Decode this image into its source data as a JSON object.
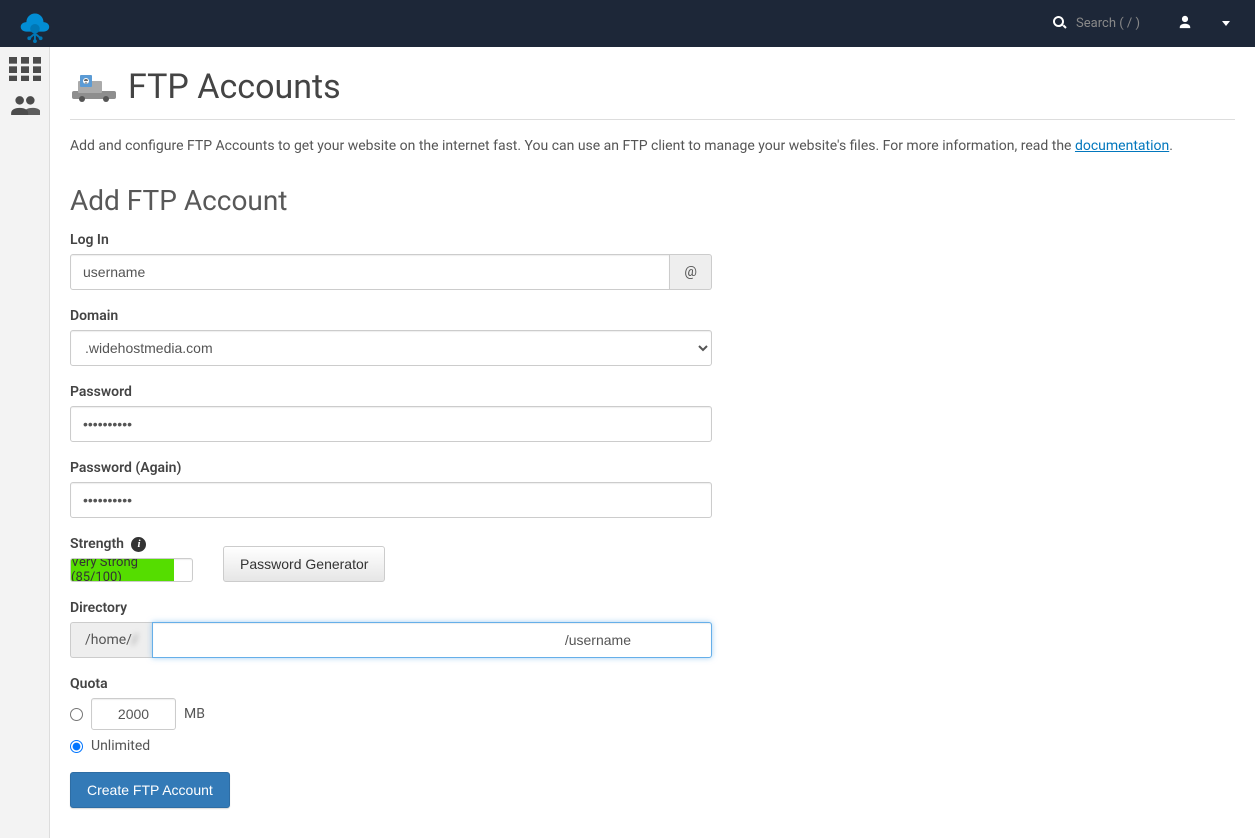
{
  "header": {
    "search_placeholder": "Search ( / )"
  },
  "page": {
    "title": "FTP Accounts",
    "description_prefix": "Add and configure FTP Accounts to get your website on the internet fast. You can use an FTP client to manage your website's files. For more information, read the ",
    "doc_link_text": "documentation",
    "description_suffix": "."
  },
  "form": {
    "section_title": "Add FTP Account",
    "login": {
      "label": "Log In",
      "value": "username",
      "addon": "@"
    },
    "domain": {
      "label": "Domain",
      "value": ".widehostmedia.com"
    },
    "password": {
      "label": "Password",
      "value": "••••••••••"
    },
    "password_again": {
      "label": "Password (Again)",
      "value": "••••••••••"
    },
    "strength": {
      "label": "Strength",
      "text": "Very Strong (85/100)",
      "percent": 85,
      "generator_label": "Password Generator"
    },
    "directory": {
      "label": "Directory",
      "prefix": "/home/",
      "prefix_obscured": "/",
      "value": "/username"
    },
    "quota": {
      "label": "Quota",
      "fixed_value": "2000",
      "unit": "MB",
      "unlimited_label": "Unlimited",
      "selected": "unlimited"
    },
    "submit_label": "Create FTP Account"
  }
}
